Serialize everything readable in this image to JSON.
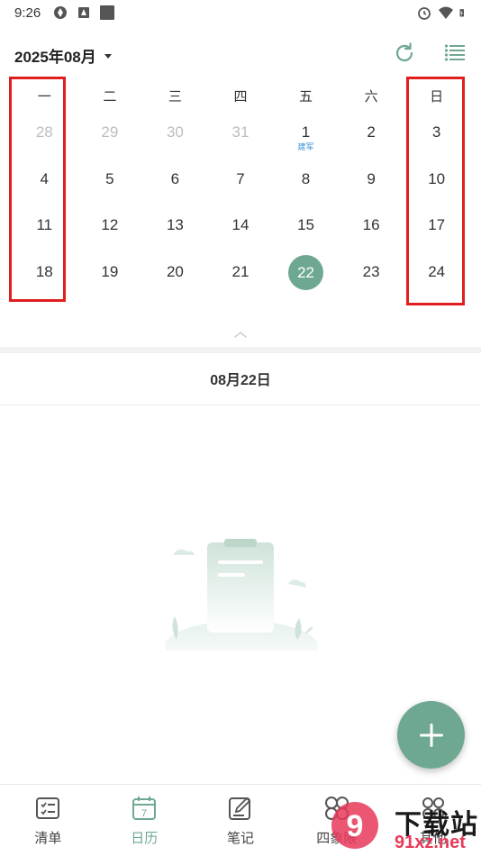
{
  "status": {
    "time": "9:26"
  },
  "header": {
    "month_title": "2025年08月"
  },
  "calendar": {
    "weekdays": [
      "一",
      "二",
      "三",
      "四",
      "五",
      "六",
      "日"
    ],
    "weeks": [
      [
        {
          "d": "28",
          "muted": true
        },
        {
          "d": "29",
          "muted": true
        },
        {
          "d": "30",
          "muted": true
        },
        {
          "d": "31",
          "muted": true
        },
        {
          "d": "1",
          "sub": "建军"
        },
        {
          "d": "2"
        },
        {
          "d": "3"
        }
      ],
      [
        {
          "d": "4"
        },
        {
          "d": "5"
        },
        {
          "d": "6"
        },
        {
          "d": "7"
        },
        {
          "d": "8"
        },
        {
          "d": "9"
        },
        {
          "d": "10"
        }
      ],
      [
        {
          "d": "11"
        },
        {
          "d": "12"
        },
        {
          "d": "13"
        },
        {
          "d": "14"
        },
        {
          "d": "15"
        },
        {
          "d": "16"
        },
        {
          "d": "17"
        }
      ],
      [
        {
          "d": "18"
        },
        {
          "d": "19"
        },
        {
          "d": "20"
        },
        {
          "d": "21"
        },
        {
          "d": "22",
          "today": true
        },
        {
          "d": "23"
        },
        {
          "d": "24"
        }
      ]
    ],
    "accent_color": "#6ea890",
    "highlight_color": "#e01e1e"
  },
  "selected_date": "08月22日",
  "bottom_nav": {
    "items": [
      {
        "label": "清单",
        "icon": "checklist-icon"
      },
      {
        "label": "日历",
        "icon": "calendar-icon",
        "active": true
      },
      {
        "label": "笔记",
        "icon": "note-icon"
      },
      {
        "label": "四象限",
        "icon": "quadrant-icon"
      },
      {
        "label": "其他",
        "icon": "more-icon"
      }
    ]
  },
  "watermark": {
    "text": "下载站",
    "url": "91xz.net"
  }
}
